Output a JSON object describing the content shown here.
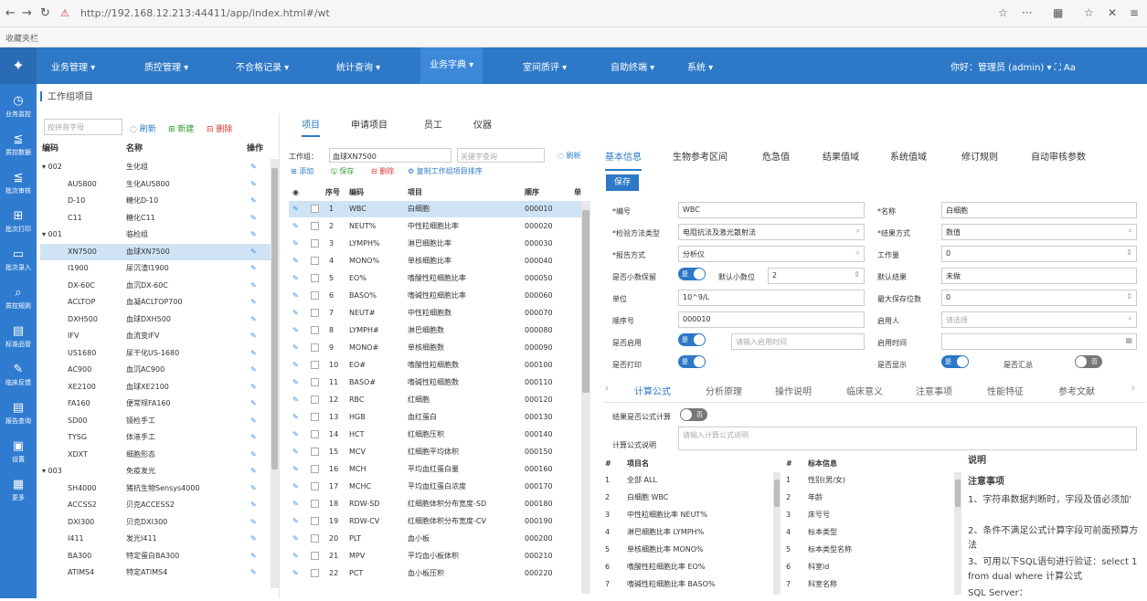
{
  "browser": {
    "url": "http://192.168.12.213:44411/app/index.html#/wt",
    "fav": "收藏夹栏",
    "right": [
      "☆",
      "···",
      "▦",
      "☆",
      "✕",
      "≡"
    ]
  },
  "topnav": {
    "menus": [
      "业务管理 ▾",
      "质控管理 ▾",
      "不合格记录 ▾",
      "统计查询 ▾",
      "业务字典 ▾",
      "室间质评 ▾",
      "自助终端 ▾",
      "系统 ▾"
    ],
    "user": "你好：管理员 (admin) ▾   ⛶   Aa"
  },
  "leftside": [
    "业务监控",
    "质控数据",
    "批次审核",
    "批次打印",
    "批次录入",
    "质控规则",
    "标准品管",
    "临床反馈",
    "报告查询",
    "设置",
    "更多"
  ],
  "page_title": "工作组项目",
  "tree": {
    "search_placeholder": "按拼音字母",
    "btn_refresh": "◌ 刷新",
    "btn_add": "⊞ 新建",
    "btn_del": "⊟ 删除",
    "headers": [
      "编码",
      "名称",
      "操作"
    ],
    "rows": [
      [
        "▾ 002",
        "生化组"
      ],
      [
        "AU5800",
        "生化AU5800"
      ],
      [
        "D-10",
        "糖化D-10"
      ],
      [
        "C11",
        "糖化C11"
      ],
      [
        "▾ 001",
        "临检组"
      ],
      [
        "XN7500",
        "血球XN7500"
      ],
      [
        "I1900",
        "尿沉渣I1900"
      ],
      [
        "DX-60C",
        "血沉DX-60C"
      ],
      [
        "ACLTOP",
        "血凝ACLTOP700"
      ],
      [
        "DXH500",
        "血球DXH500"
      ],
      [
        "IFV",
        "血流变IFV"
      ],
      [
        "US1680",
        "尿干化US-1680"
      ],
      [
        "AC900",
        "血沉AC900"
      ],
      [
        "XE2100",
        "血球XE2100"
      ],
      [
        "FA160",
        "便常规FA160"
      ],
      [
        "SD00",
        "镜检手工"
      ],
      [
        "TYSG",
        "体液手工"
      ],
      [
        "XDXT",
        "细胞形态"
      ],
      [
        "▾ 003",
        "免疫发光"
      ],
      [
        "SH4000",
        "猪抗生物Sensys4000"
      ],
      [
        "ACCSS2",
        "贝克ACCESS2"
      ],
      [
        "DXI300",
        "贝克DXI300"
      ],
      [
        "I411",
        "发光I411"
      ],
      [
        "BA300",
        "特定蛋白BA300"
      ],
      [
        "ATIMS4",
        "特定ATIMS4"
      ]
    ]
  },
  "mid": {
    "tabs": [
      "项目",
      "申请项目",
      "员工",
      "仪器"
    ],
    "group_label": "工作组：",
    "group_value": "血球XN7500",
    "search_placeholder": "关键字查询",
    "refresh": "◌ 刷新",
    "actions": [
      "⊞ 添加",
      "🖫 保存",
      "⊟ 删除",
      "⚙ 复制工作组项目排序"
    ],
    "headers": [
      "◉",
      "序号",
      "编码",
      "项目",
      "顺序",
      "单"
    ],
    "rows": [
      [
        "1",
        "WBC",
        "白细胞",
        "000010"
      ],
      [
        "2",
        "NEUT%",
        "中性粒细胞比率",
        "000020"
      ],
      [
        "3",
        "LYMPH%",
        "淋巴细胞比率",
        "000030"
      ],
      [
        "4",
        "MONO%",
        "单核细胞比率",
        "000040"
      ],
      [
        "5",
        "EO%",
        "嗜酸性粒细胞比率",
        "000050"
      ],
      [
        "6",
        "BASO%",
        "嗜碱性粒细胞比率",
        "000060"
      ],
      [
        "7",
        "NEUT#",
        "中性粒细胞数",
        "000070"
      ],
      [
        "8",
        "LYMPH#",
        "淋巴细胞数",
        "000080"
      ],
      [
        "9",
        "MONO#",
        "单核细胞数",
        "000090"
      ],
      [
        "10",
        "EO#",
        "嗜酸性粒细胞数",
        "000100"
      ],
      [
        "11",
        "BASO#",
        "嗜碱性粒细胞数",
        "000110"
      ],
      [
        "12",
        "RBC",
        "红细胞",
        "000120"
      ],
      [
        "13",
        "HGB",
        "血红蛋白",
        "000130"
      ],
      [
        "14",
        "HCT",
        "红细胞压积",
        "000140"
      ],
      [
        "15",
        "MCV",
        "红细胞平均体积",
        "000150"
      ],
      [
        "16",
        "MCH",
        "平均血红蛋白量",
        "000160"
      ],
      [
        "17",
        "MCHC",
        "平均血红蛋白浓度",
        "000170"
      ],
      [
        "18",
        "RDW-SD",
        "红细胞体积分布宽度-SD",
        "000180"
      ],
      [
        "19",
        "RDW-CV",
        "红细胞体积分布宽度-CV",
        "000190"
      ],
      [
        "20",
        "PLT",
        "血小板",
        "000200"
      ],
      [
        "21",
        "MPV",
        "平均血小板体积",
        "000210"
      ],
      [
        "22",
        "PCT",
        "血小板压积",
        "000220"
      ]
    ]
  },
  "right": {
    "tabs": [
      "基本信息",
      "生物参考区间",
      "危急值",
      "结果值域",
      "系统值域",
      "修订规则",
      "自动审核参数"
    ],
    "save": "保存",
    "fields": {
      "code_l": "*编号",
      "code_v": "WBC",
      "name_l": "*名称",
      "name_v": "白细胞",
      "method_l": "*检验方法类型",
      "method_v": "电阻抗法及激光散射法",
      "mode_l": "*结果方式",
      "mode_v": "数值",
      "alg_l": "*报告方式",
      "alg_v": "分析仪",
      "work_l": "工作量",
      "work_v": "0",
      "decimal_l": "是否小数保留",
      "decimal_sw": "是",
      "dec_count_l": "默认小数位",
      "dec_count_v": "2",
      "default_l": "默认结果",
      "default_v": "未做",
      "unit_l": "单位",
      "unit_v": "10^9/L",
      "max_l": "最大保存位数",
      "max_v": "0",
      "order_l": "顺序号",
      "order_v": "000010",
      "user_l": "启用人",
      "user_v": "请选择",
      "enable_l": "是否启用",
      "enable_sw": "是",
      "enable_ph": "请输入启用时间",
      "time_l": "启用时间",
      "print_l": "是否打印",
      "print_sw": "是",
      "mark_l": "是否显示",
      "mark_sw": "是",
      "sum_l": "是否汇总",
      "sum_sw": "否"
    },
    "subtabs": [
      "计算公式",
      "分析原理",
      "操作说明",
      "临床意义",
      "注意事项",
      "性能特征",
      "参考文献"
    ],
    "calc_l": "结果是否公式计算",
    "calc_sw": "否",
    "formula_l": "计算公式说明",
    "formula_ph": "请输入计算公式说明",
    "t1_headers": [
      "#",
      "项目名"
    ],
    "t1_rows": [
      [
        "1",
        "全部 ALL"
      ],
      [
        "2",
        "白细胞 WBC"
      ],
      [
        "3",
        "中性粒细胞比率 NEUT%"
      ],
      [
        "4",
        "淋巴细胞比率 LYMPH%"
      ],
      [
        "5",
        "单核细胞比率 MONO%"
      ],
      [
        "6",
        "嗜酸性粒细胞比率 EO%"
      ],
      [
        "7",
        "嗜碱性粒细胞比率 BASO%"
      ]
    ],
    "t2_headers": [
      "#",
      "标本信息"
    ],
    "t2_rows": [
      [
        "1",
        "性别(男/女)"
      ],
      [
        "2",
        "年龄"
      ],
      [
        "3",
        "床号号"
      ],
      [
        "4",
        "标本类型"
      ],
      [
        "5",
        "标本类型名称"
      ],
      [
        "6",
        "科室id"
      ],
      [
        "7",
        "科室名称"
      ]
    ],
    "note_title": "说明",
    "note_sub": "注意事项",
    "notes": [
      "1、字符串数据判断时，字段及值必须加'",
      "2、条件不满足公式计算字段可前面预算方法",
      "3、可用以下SQL语句进行验证：select 1 from dual where 计算公式",
      "SQL Server："
    ]
  }
}
